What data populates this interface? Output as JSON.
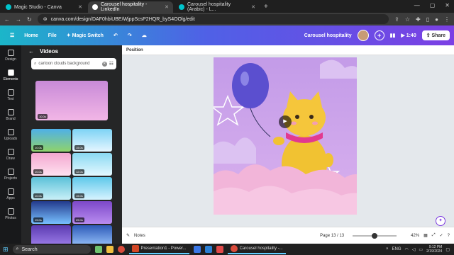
{
  "browser": {
    "tabs": [
      {
        "title": "Magic Studio - Canva",
        "active": false,
        "icon_color": "#00c4cc"
      },
      {
        "title": "Carousel hospitality - LinkedIn",
        "active": true,
        "icon_color": "#ffffff"
      },
      {
        "title": "Carousel hospitality (Arabic) - L...",
        "active": false,
        "icon_color": "#00c4cc"
      }
    ],
    "url": "canva.com/design/DAF0hbiUBE/WjppScsP2HQR_byS4OOlg/edit"
  },
  "topnav": {
    "home": "Home",
    "file": "File",
    "magic_switch": "Magic Switch",
    "design_title": "Carousel hospitality",
    "timer": "1:40",
    "share": "Share"
  },
  "rail": [
    {
      "name": "design",
      "label": "Design"
    },
    {
      "name": "elements",
      "label": "Elements",
      "active": true
    },
    {
      "name": "text",
      "label": "Text"
    },
    {
      "name": "brand",
      "label": "Brand"
    },
    {
      "name": "uploads",
      "label": "Uploads"
    },
    {
      "name": "draw",
      "label": "Draw"
    },
    {
      "name": "projects",
      "label": "Projects"
    },
    {
      "name": "apps",
      "label": "Apps"
    },
    {
      "name": "photos",
      "label": "Photos"
    }
  ],
  "panel": {
    "title": "Videos",
    "search_value": "cartoon clouds background",
    "thumbs": [
      {
        "duration": "10.0s",
        "colors": [
          "#c88ad8",
          "#f2b6e6"
        ]
      },
      {
        "duration": "10.0s",
        "colors": [
          "#4fb0e8",
          "#8fd36a"
        ]
      },
      {
        "duration": "15.0s",
        "colors": [
          "#7dd3f5",
          "#e6f6ff"
        ]
      },
      {
        "duration": "10.0s",
        "colors": [
          "#f3a7cf",
          "#ffe1f0"
        ]
      },
      {
        "duration": "12.0s",
        "colors": [
          "#8ad8f2",
          "#e4f8ff"
        ]
      },
      {
        "duration": "10.0s",
        "colors": [
          "#5bc1d9",
          "#c9f0f7"
        ]
      },
      {
        "duration": "15.0s",
        "colors": [
          "#5ec8ea",
          "#d7f3ff"
        ]
      },
      {
        "duration": "15.0s",
        "colors": [
          "#233a8c",
          "#78c0ff"
        ]
      },
      {
        "duration": "25.0s",
        "colors": [
          "#7c48c8",
          "#b98cf0"
        ]
      },
      {
        "duration": "",
        "colors": [
          "#5b3bb0",
          "#a383ef"
        ]
      },
      {
        "duration": "",
        "colors": [
          "#2d5ab8",
          "#9ec9ff"
        ]
      }
    ]
  },
  "canvas": {
    "position_label": "Position",
    "notes": "Notes",
    "page": "Page 13 / 13",
    "zoom": "42%",
    "page_progress": 0.5
  },
  "taskbar": {
    "search": "Search",
    "windows": [
      "Presentation1 - Power...",
      "Carousel hospitality -..."
    ],
    "lang": "ENG",
    "time": "9:12 PM",
    "date": "2/19/2024"
  }
}
